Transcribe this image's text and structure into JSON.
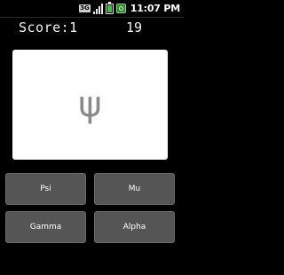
{
  "status_bar": {
    "network_label": "3G",
    "time": "11:07 PM",
    "icons": [
      "3g-icon",
      "signal-icon",
      "battery-icon",
      "app-icon"
    ]
  },
  "game": {
    "score_label": "Score:1",
    "timer_value": "19",
    "symbol": "ψ"
  },
  "answers": [
    {
      "label": "Psi"
    },
    {
      "label": "Mu"
    },
    {
      "label": "Gamma"
    },
    {
      "label": "Alpha"
    }
  ]
}
